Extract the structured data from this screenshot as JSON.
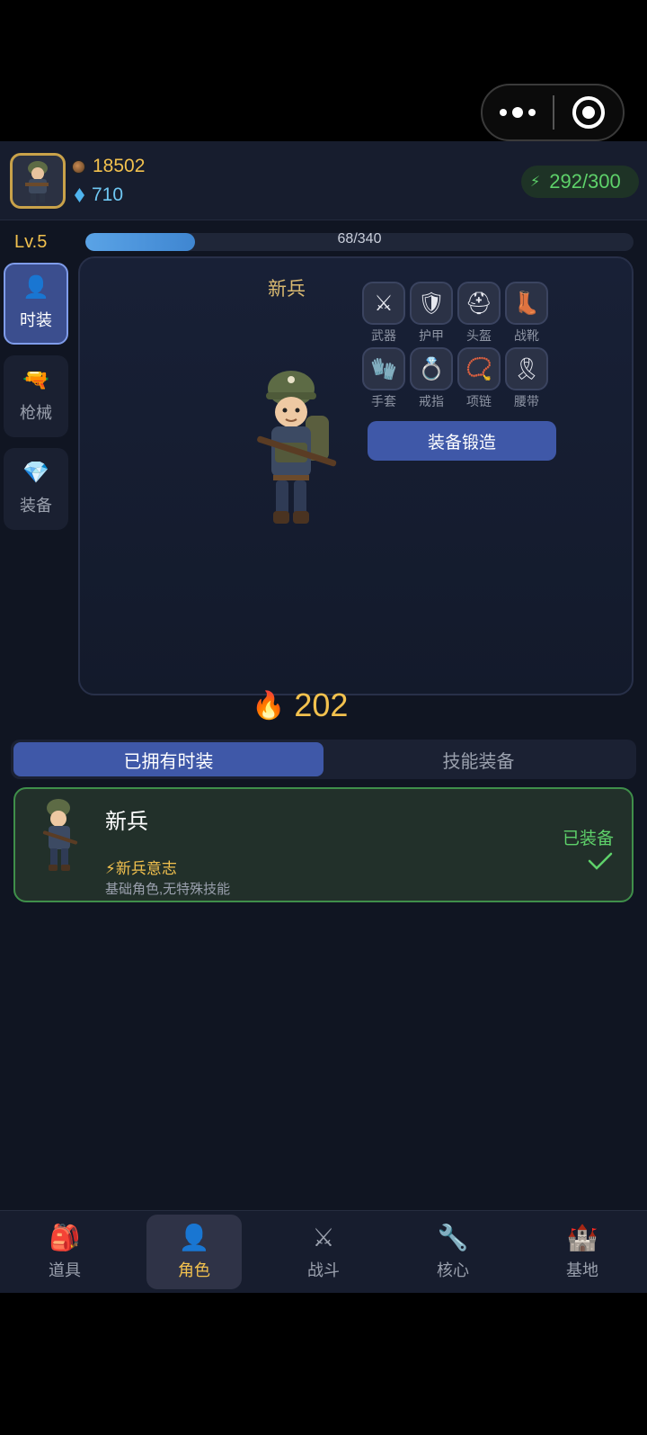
{
  "player": {
    "gold": "18502",
    "gems": "710",
    "energy": "292/300",
    "level": "Lv.5",
    "xp_text": "68/340",
    "xp_fraction": 0.2
  },
  "sidebar": [
    {
      "label": "时装",
      "icon": "person-icon",
      "active": true
    },
    {
      "label": "枪械",
      "icon": "gun-icon",
      "active": false
    },
    {
      "label": "装备",
      "icon": "diamond-icon",
      "active": false
    }
  ],
  "character": {
    "name": "新兵"
  },
  "equipment_slots": [
    {
      "label": "武器",
      "icon": "swords-icon",
      "glyph": "⚔"
    },
    {
      "label": "护甲",
      "icon": "shield-icon",
      "glyph": "🛡"
    },
    {
      "label": "头盔",
      "icon": "helmet-icon",
      "glyph": "⛑"
    },
    {
      "label": "战靴",
      "icon": "boot-icon",
      "glyph": "👢"
    },
    {
      "label": "手套",
      "icon": "glove-icon",
      "glyph": "🧤"
    },
    {
      "label": "戒指",
      "icon": "ring-icon",
      "glyph": "💍"
    },
    {
      "label": "项链",
      "icon": "necklace-icon",
      "glyph": "📿"
    },
    {
      "label": "腰带",
      "icon": "ribbon-icon",
      "glyph": "🎗"
    }
  ],
  "forge_button": "装备锻造",
  "power": "202",
  "tabs": [
    {
      "label": "已拥有时装",
      "active": true
    },
    {
      "label": "技能装备",
      "active": false
    }
  ],
  "skins": [
    {
      "name": "新兵",
      "skill": "⚡新兵意志",
      "description": "基础角色,无特殊技能",
      "status": "已装备"
    }
  ],
  "bottom_nav": [
    {
      "label": "道具",
      "icon": "backpack-icon",
      "glyph": "🎒",
      "active": false
    },
    {
      "label": "角色",
      "icon": "person-icon",
      "glyph": "👤",
      "active": true
    },
    {
      "label": "战斗",
      "icon": "swords-icon",
      "glyph": "⚔",
      "active": false
    },
    {
      "label": "核心",
      "icon": "wrench-icon",
      "glyph": "🔧",
      "active": false
    },
    {
      "label": "基地",
      "icon": "castle-icon",
      "glyph": "🏰",
      "active": false
    }
  ],
  "colors": {
    "accent_gold": "#f2c14e",
    "accent_blue": "#3f58a8",
    "energy_green": "#5ed16a",
    "background": "#101522"
  }
}
